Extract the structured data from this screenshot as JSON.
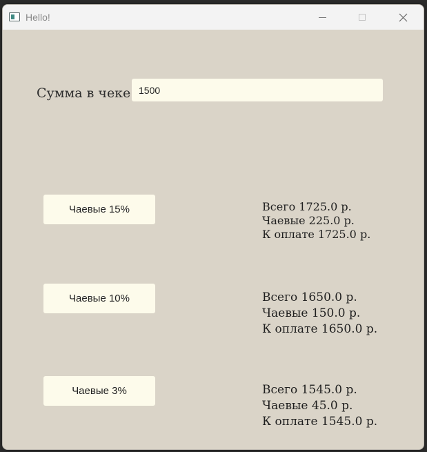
{
  "window": {
    "title": "Hello!",
    "icons": {
      "app": "app-window-icon",
      "minimize": "minimize-icon",
      "maximize": "maximize-icon",
      "close": "close-icon"
    }
  },
  "form": {
    "bill_label": "Сумма в чеке:",
    "bill_value": "1500"
  },
  "tips": [
    {
      "button_label": "Чаевые 15%",
      "total": "Всего 1725.0 р.",
      "tip": "Чаевые 225.0 р.",
      "to_pay": "К оплате 1725.0 р."
    },
    {
      "button_label": "Чаевые 10%",
      "total": "Всего 1650.0 р.",
      "tip": "Чаевые 150.0 р.",
      "to_pay": "К оплате 1650.0 р."
    },
    {
      "button_label": "Чаевые 3%",
      "total": "Всего 1545.0 р.",
      "tip": "Чаевые 45.0 р.",
      "to_pay": "К оплате 1545.0 р."
    }
  ],
  "colors": {
    "background": "#dad4c8",
    "field_background": "#fdfbeb",
    "titlebar": "#f3f3f3"
  }
}
